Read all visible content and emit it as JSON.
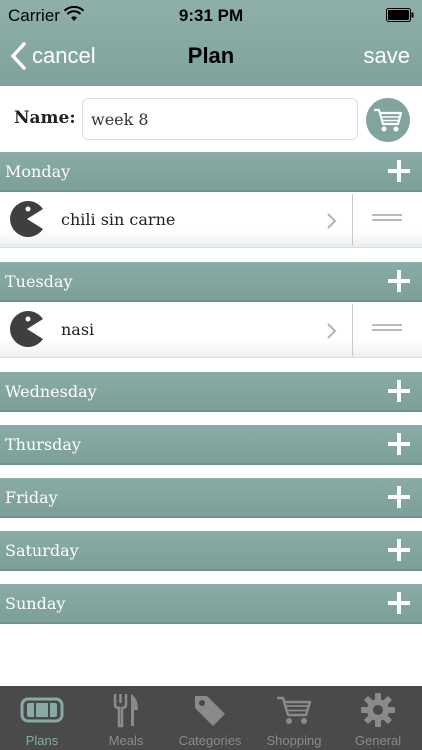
{
  "status_bar": {
    "carrier": "Carrier",
    "time": "9:31 PM"
  },
  "nav": {
    "back_label": "cancel",
    "title": "Plan",
    "save_label": "save"
  },
  "plan": {
    "name_label": "Name:",
    "name_value": "week 8"
  },
  "days": [
    {
      "label": "Monday",
      "meals": [
        "chili sin carne"
      ]
    },
    {
      "label": "Tuesday",
      "meals": [
        "nasi"
      ]
    },
    {
      "label": "Wednesday",
      "meals": []
    },
    {
      "label": "Thursday",
      "meals": []
    },
    {
      "label": "Friday",
      "meals": []
    },
    {
      "label": "Saturday",
      "meals": []
    },
    {
      "label": "Sunday",
      "meals": []
    }
  ],
  "tabs": [
    {
      "label": "Plans",
      "icon": "plans-icon",
      "active": true
    },
    {
      "label": "Meals",
      "icon": "fork-knife-icon",
      "active": false
    },
    {
      "label": "Categories",
      "icon": "tag-icon",
      "active": false
    },
    {
      "label": "Shopping",
      "icon": "cart-icon",
      "active": false
    },
    {
      "label": "General",
      "icon": "gear-icon",
      "active": false
    }
  ],
  "colors": {
    "accent": "#81a49e",
    "tab_bar": "#4a4a4a",
    "header_text": "#ffffff"
  }
}
